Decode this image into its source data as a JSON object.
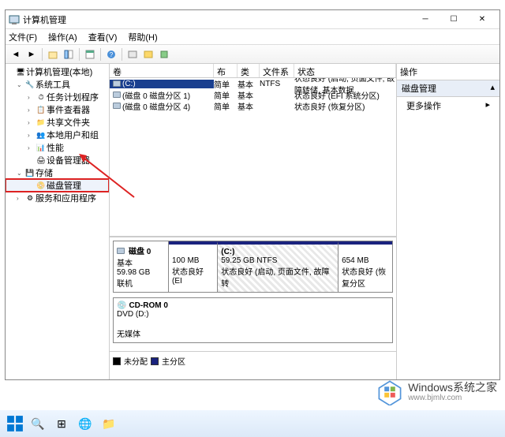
{
  "window": {
    "title": "计算机管理"
  },
  "menu": {
    "file": "文件(F)",
    "action": "操作(A)",
    "view": "查看(V)",
    "help": "帮助(H)"
  },
  "tree": {
    "root": "计算机管理(本地)",
    "systools": "系统工具",
    "tasksched": "任务计划程序",
    "eventviewer": "事件查看器",
    "sharedfolders": "共享文件夹",
    "localusers": "本地用户和组",
    "performance": "性能",
    "devicemgr": "设备管理器",
    "storage": "存储",
    "diskmgmt": "磁盘管理",
    "services": "服务和应用程序"
  },
  "vol_headers": {
    "vol": "卷",
    "layout": "布局",
    "type": "类型",
    "fs": "文件系统",
    "status": "状态"
  },
  "volumes": [
    {
      "name": "(C:)",
      "layout": "简单",
      "type": "基本",
      "fs": "NTFS",
      "status": "状态良好 (启动, 页面文件, 故障转储, 基本数据"
    },
    {
      "name": "(磁盘 0 磁盘分区 1)",
      "layout": "简单",
      "type": "基本",
      "fs": "",
      "status": "状态良好 (EFI 系统分区)"
    },
    {
      "name": "(磁盘 0 磁盘分区 4)",
      "layout": "简单",
      "type": "基本",
      "fs": "",
      "status": "状态良好 (恢复分区)"
    }
  ],
  "disk0": {
    "title": "磁盘 0",
    "type": "基本",
    "size": "59.98 GB",
    "status": "联机",
    "p1": {
      "size": "100 MB",
      "status": "状态良好 (EI"
    },
    "p2": {
      "label": "(C:)",
      "size": "59.25 GB NTFS",
      "status": "状态良好 (启动, 页面文件, 故障转"
    },
    "p3": {
      "size": "654 MB",
      "status": "状态良好 (恢复分区"
    }
  },
  "cdrom": {
    "title": "CD-ROM 0",
    "label": "DVD (D:)",
    "status": "无媒体"
  },
  "legend": {
    "unallocated": "未分配",
    "primary": "主分区"
  },
  "actions": {
    "title": "操作",
    "diskmgmt": "磁盘管理",
    "more": "更多操作"
  },
  "watermark": {
    "brand": "Windows系统之家",
    "url": "www.bjmlv.com"
  }
}
